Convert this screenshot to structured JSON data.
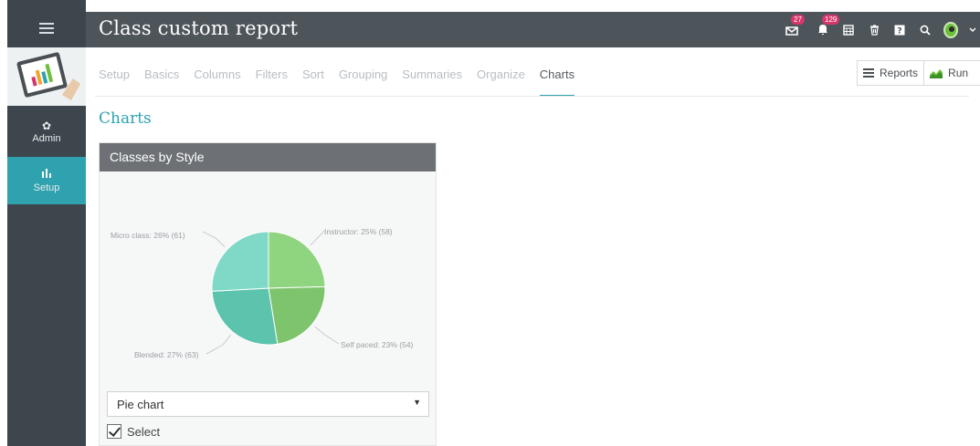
{
  "header": {
    "title": "Class custom report",
    "notifications": {
      "messages_count": "27",
      "alerts_count": "129"
    },
    "icons": [
      "menu-icon",
      "messages-icon",
      "bell-icon",
      "calendar-icon",
      "trash-icon",
      "help-icon",
      "search-icon",
      "avatar",
      "chevron-down-icon"
    ]
  },
  "sidebar": {
    "items": [
      {
        "label": "Admin",
        "icon": "gear-icon"
      },
      {
        "label": "Setup",
        "icon": "bar-chart-icon"
      }
    ]
  },
  "tabs": [
    {
      "label": "Setup"
    },
    {
      "label": "Basics"
    },
    {
      "label": "Columns"
    },
    {
      "label": "Filters"
    },
    {
      "label": "Sort"
    },
    {
      "label": "Grouping"
    },
    {
      "label": "Summaries"
    },
    {
      "label": "Organize"
    },
    {
      "label": "Charts",
      "active": true
    }
  ],
  "actions": {
    "reports_label": "Reports",
    "run_label": "Run"
  },
  "main": {
    "section_title": "Charts",
    "card": {
      "title": "Classes by Style",
      "chart_type_select": {
        "value": "Pie chart"
      },
      "select_checkbox": {
        "label": "Select",
        "checked": true
      }
    }
  },
  "colors": {
    "accent": "#2ea2ae",
    "topbar": "#4d555b",
    "sidebar": "#3d464c",
    "badge": "#d9366b"
  },
  "chart_data": {
    "type": "pie",
    "title": "",
    "slices": [
      {
        "name": "Instructor",
        "percent": 25,
        "value": 58,
        "label": "Instructor: 25% (58)",
        "color": "#8fd47f"
      },
      {
        "name": "Self paced",
        "percent": 23,
        "value": 54,
        "label": "Self paced: 23% (54)",
        "color": "#7ec46d"
      },
      {
        "name": "Blended",
        "percent": 27,
        "value": 63,
        "label": "Blended: 27% (63)",
        "color": "#5cc3ad"
      },
      {
        "name": "Micro class",
        "percent": 26,
        "value": 61,
        "label": "Micro class: 26% (61)",
        "color": "#7fd9c6"
      }
    ]
  }
}
